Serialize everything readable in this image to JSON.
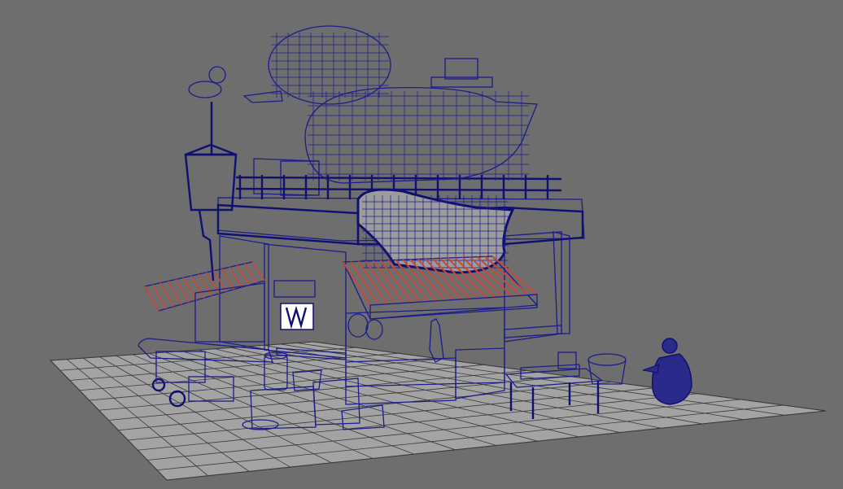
{
  "viewport": {
    "background": "#6e6e6e",
    "wireframe_color": "#1c1c8c",
    "grid_color": "#3a3a3a",
    "surface_gray": "#999999",
    "accent_salmon": "#e07a63",
    "wood_tan": "#c9926a"
  },
  "scene": {
    "objects": [
      "ground-grid",
      "food-stall-building",
      "rooftop-goose-sculpture",
      "hanging-goose-sign",
      "duck-weathervane",
      "water-tank",
      "striped-awning",
      "side-cart",
      "wooden-crates",
      "milk-can",
      "side-table",
      "basket",
      "goose-statue"
    ]
  }
}
